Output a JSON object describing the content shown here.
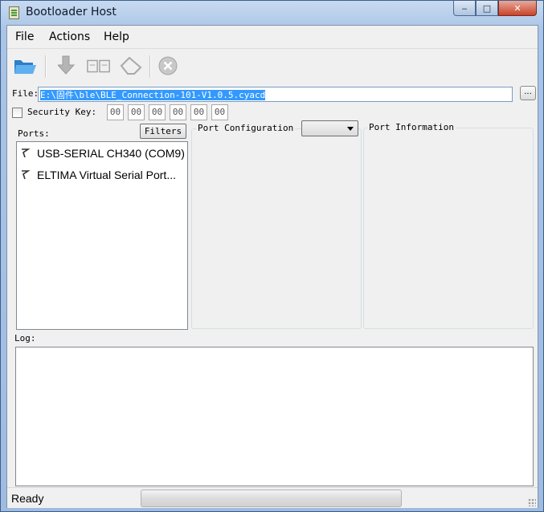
{
  "window": {
    "title": "Bootloader Host",
    "caption_min": "‒",
    "caption_max": "□",
    "caption_close": "✕"
  },
  "menu": {
    "file": "File",
    "actions": "Actions",
    "help": "Help"
  },
  "toolbar": {
    "icons": [
      "open-folder-icon",
      "program-icon",
      "verify-icon",
      "erase-icon",
      "abort-icon"
    ]
  },
  "file": {
    "label": "File:",
    "value": "E:\\固件\\ble\\BLE_Connection-101-V1.0.5.cyacd",
    "browse_label": "..."
  },
  "security": {
    "label": "Security Key:",
    "checked": false,
    "key_bytes": [
      "00",
      "00",
      "00",
      "00",
      "00",
      "00"
    ]
  },
  "ports": {
    "label": "Ports:",
    "filters_label": "Filters",
    "items": [
      "USB-SERIAL CH340 (COM9)",
      "ELTIMA Virtual Serial Port..."
    ]
  },
  "port_configuration": {
    "label": "Port Configuration",
    "selected": ""
  },
  "port_information": {
    "label": "Port Information"
  },
  "log": {
    "label": "Log:",
    "content": ""
  },
  "status": {
    "text": "Ready",
    "progress": 0
  },
  "colors": {
    "title_bar": "#a9c4e6",
    "selection": "#3399ff",
    "close_button": "#c8442b"
  }
}
